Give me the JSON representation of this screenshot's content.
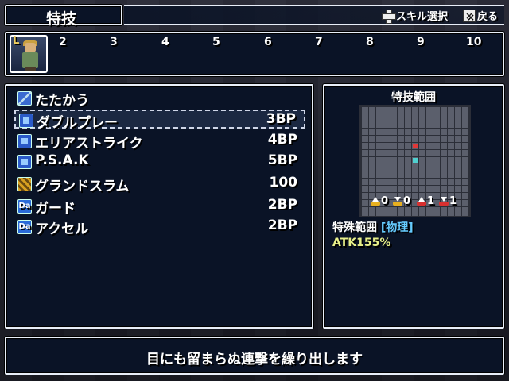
{
  "header": {
    "title": "特技",
    "hint_select": "スキル選択",
    "hint_back": "戻る"
  },
  "turn_order": {
    "portrait_letter": "L",
    "numbers": [
      "2",
      "3",
      "4",
      "5",
      "6",
      "7",
      "8",
      "9",
      "10"
    ]
  },
  "skills": [
    {
      "icon": "sword-icon",
      "name": "たたかう",
      "cost": ""
    },
    {
      "icon": "skill-box-icon",
      "name": "ダブルプレー",
      "cost": "3BP"
    },
    {
      "icon": "skill-box-icon",
      "name": "エリアストライク",
      "cost": "4BP"
    },
    {
      "icon": "skill-box-icon",
      "name": "P.S.A.K",
      "cost": "5BP"
    },
    {
      "icon": "gold-skill-icon",
      "name": "グランドスラム",
      "cost": "100"
    },
    {
      "icon": "da-icon",
      "name": "ガード",
      "cost": "2BP"
    },
    {
      "icon": "da-icon",
      "name": "アクセル",
      "cost": "2BP"
    }
  ],
  "da_icon_label": "Da",
  "selected_index": 1,
  "range": {
    "title": "特技範囲",
    "type_label": "特殊範囲",
    "type_tag": "[物理]",
    "stat": "ATK155%",
    "modifiers": [
      {
        "color": "yellow",
        "dir": "up",
        "value": "0"
      },
      {
        "color": "yellow",
        "dir": "down",
        "value": "0"
      },
      {
        "color": "red",
        "dir": "up",
        "value": "1"
      },
      {
        "color": "red",
        "dir": "down",
        "value": "1"
      }
    ],
    "cell_colors": {
      "target": "#e03838",
      "self": "#50d0d0"
    }
  },
  "description": "目にも留まらぬ連撃を繰り出します"
}
